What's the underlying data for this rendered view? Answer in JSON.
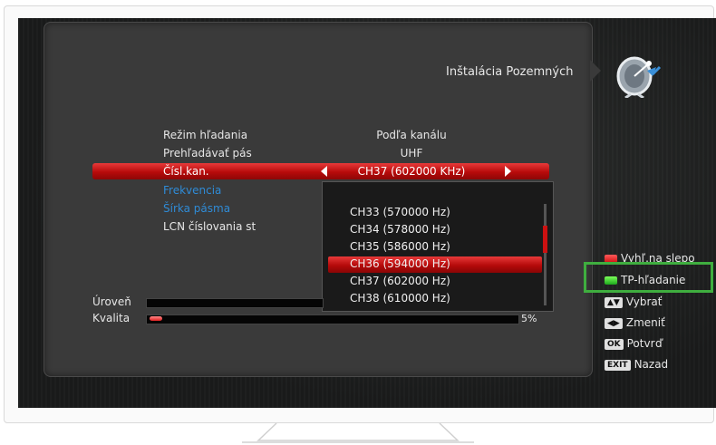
{
  "header": {
    "title": "Inštalácia Pozemných",
    "dish_icon": "satellite-dish-icon"
  },
  "menu": {
    "items": [
      {
        "label": "Režim hľadania",
        "value": "Podľa kanálu"
      },
      {
        "label": "Prehľadávať pás",
        "value": "UHF"
      },
      {
        "label": "Čísl.kan.",
        "value": "CH37 (602000 KHz)"
      },
      {
        "label": "Frekvencia",
        "value": ""
      },
      {
        "label": "Šírka pásma",
        "value": ""
      },
      {
        "label": "LCN číslovania st",
        "value": ""
      }
    ]
  },
  "dropdown": {
    "options": [
      "CH33 (570000 Hz)",
      "CH34 (578000 Hz)",
      "CH35 (586000 Hz)",
      "CH36 (594000 Hz)",
      "CH37 (602000 Hz)",
      "CH38 (610000 Hz)"
    ],
    "selected": "CH36 (594000 Hz)"
  },
  "signal": {
    "level_label": "Úroveň",
    "quality_label": "Kvalita",
    "quality_percent": "5%"
  },
  "legend": {
    "red": "Vyhľ.na slepo",
    "green": "TP-hľadanie",
    "updown_key": "▲▼",
    "updown": "Vybrať",
    "leftright_key": "◀▶",
    "leftright": "Zmeniť",
    "ok_key": "OK",
    "ok": "Potvrď",
    "exit_key": "EXIT",
    "exit": "Nazad"
  },
  "colors": {
    "selection": "#c41212",
    "highlight_box": "#3fae3f",
    "link_blue": "#2f8bd6"
  }
}
